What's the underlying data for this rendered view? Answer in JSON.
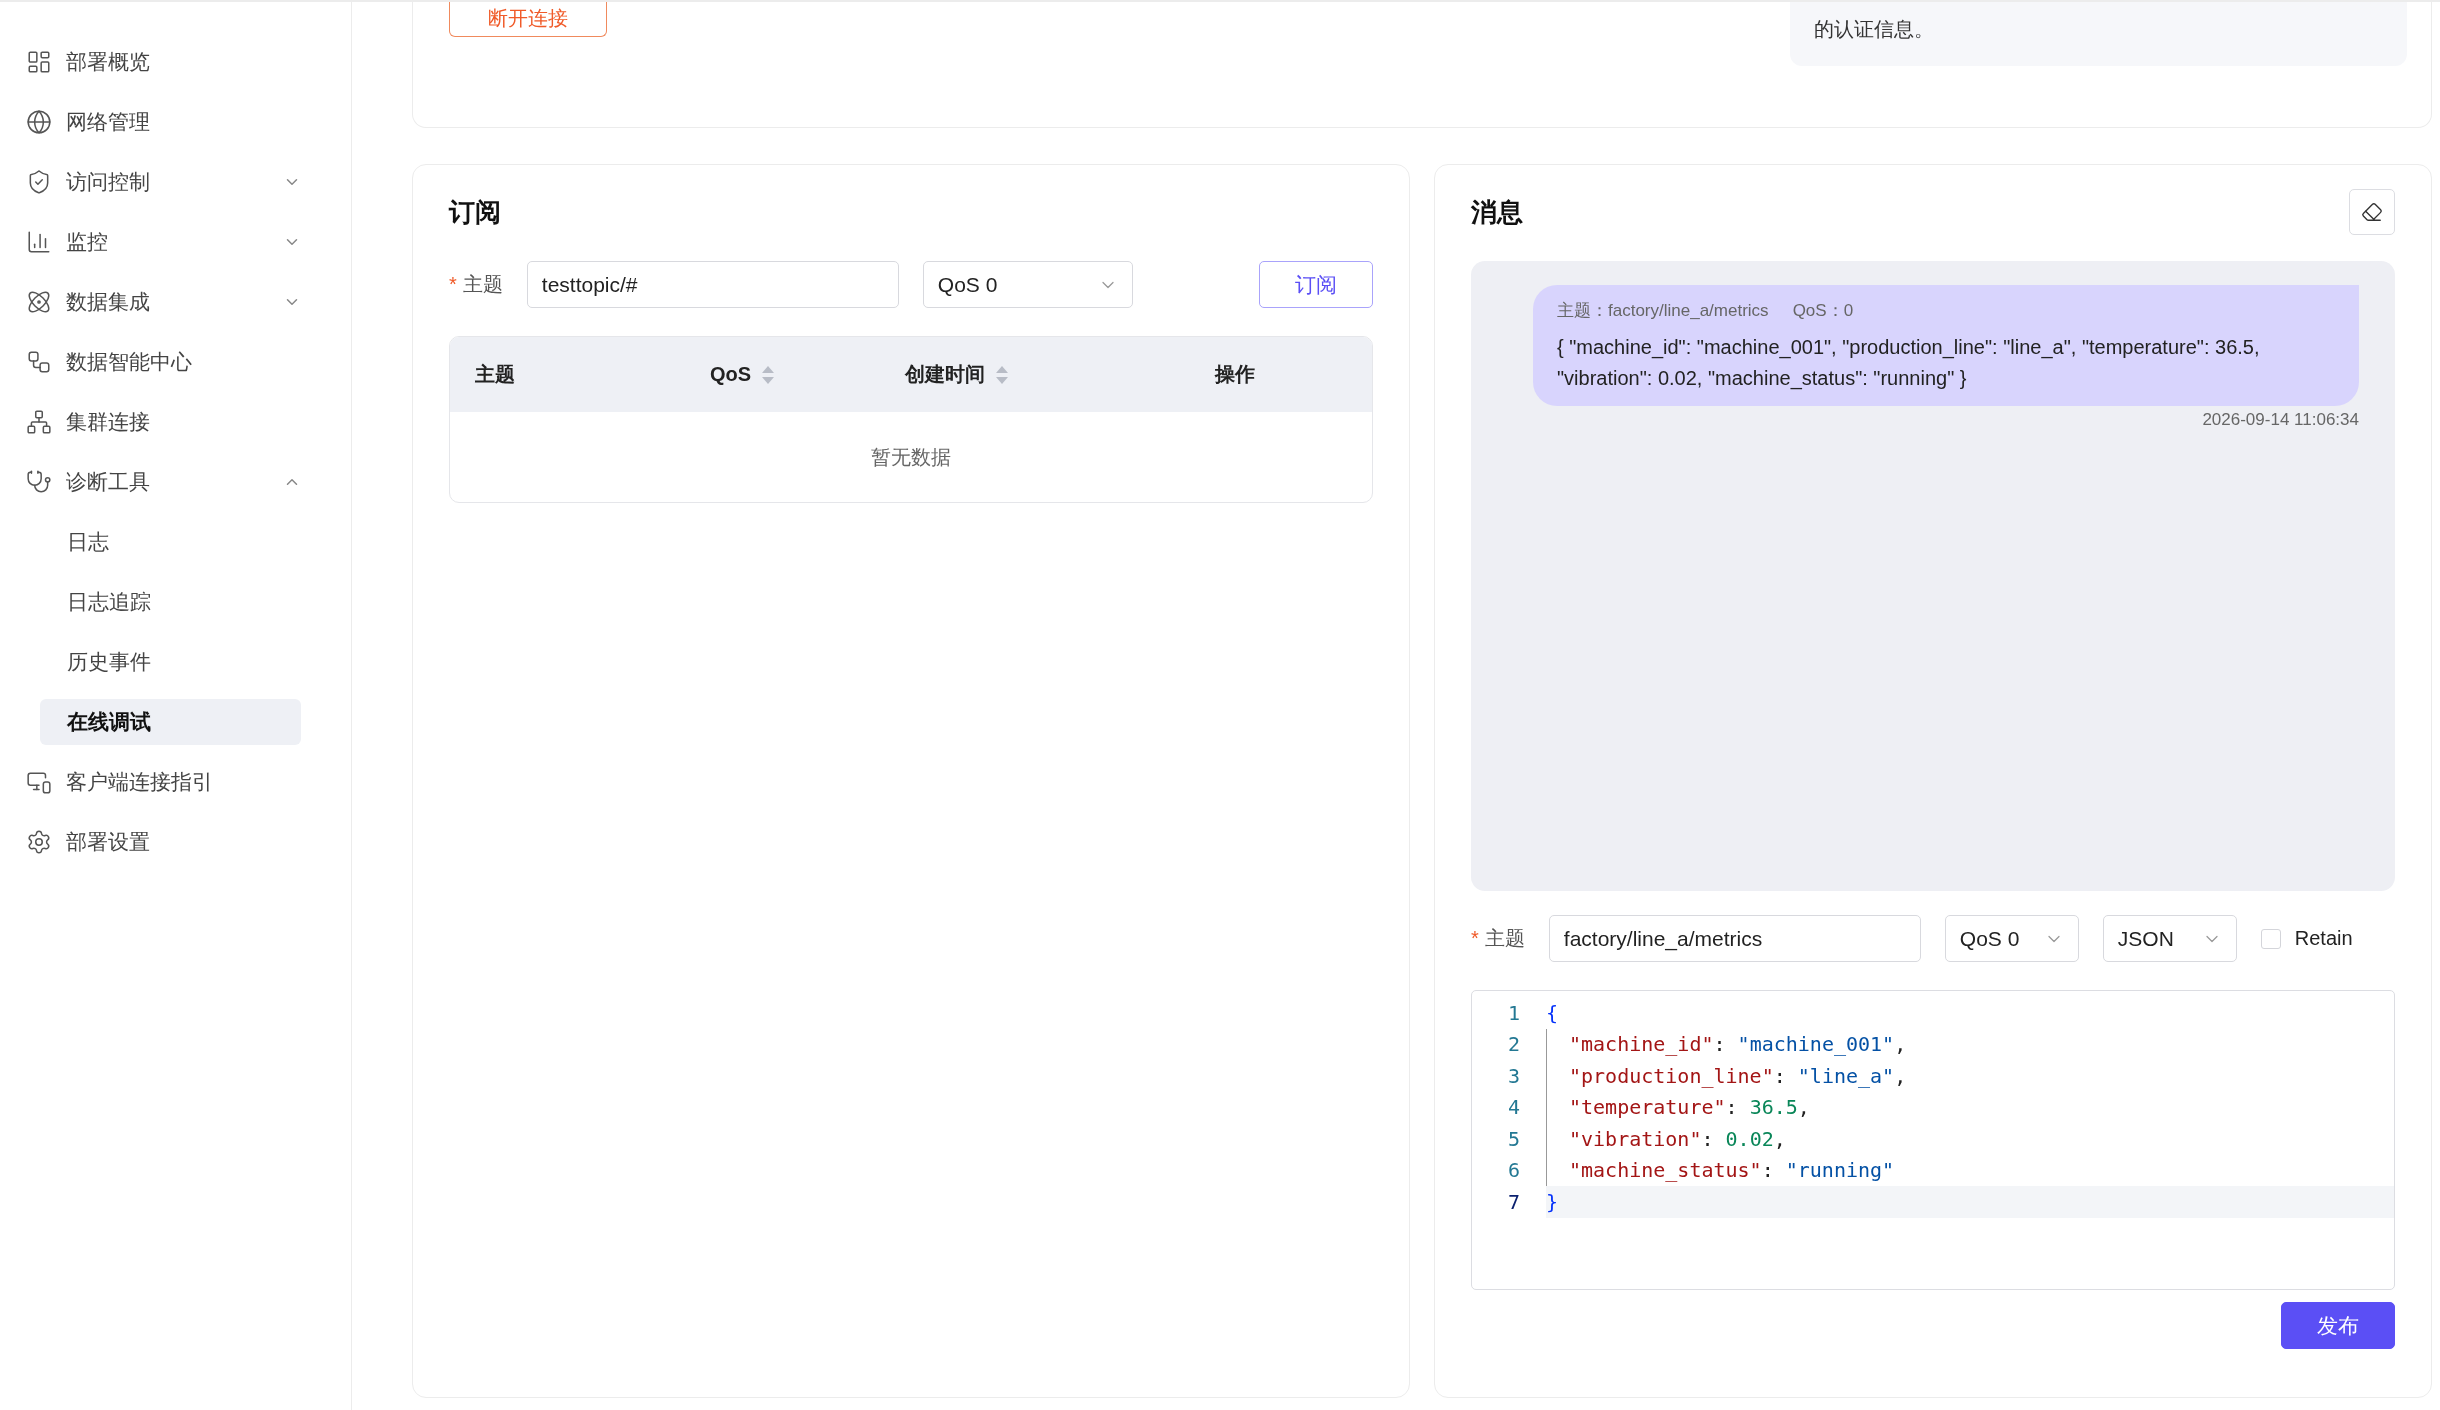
{
  "sidebar": {
    "items": [
      {
        "label": "部署概览",
        "selected": false
      },
      {
        "label": "网络管理",
        "selected": false
      },
      {
        "label": "访问控制",
        "selected": false,
        "expanded": false
      },
      {
        "label": "监控",
        "selected": false,
        "expanded": false
      },
      {
        "label": "数据集成",
        "selected": false,
        "expanded": false
      },
      {
        "label": "数据智能中心",
        "selected": false
      },
      {
        "label": "集群连接",
        "selected": false
      },
      {
        "label": "诊断工具",
        "selected": false,
        "expanded": true,
        "children": [
          {
            "label": "日志",
            "selected": false
          },
          {
            "label": "日志追踪",
            "selected": false
          },
          {
            "label": "历史事件",
            "selected": false
          },
          {
            "label": "在线调试",
            "selected": true
          }
        ]
      },
      {
        "label": "客户端连接指引",
        "selected": false
      },
      {
        "label": "部署设置",
        "selected": false
      }
    ]
  },
  "connection": {
    "disconnect_button": "断开连接",
    "info_text": "的认证信息。"
  },
  "subscribe": {
    "title": "订阅",
    "required_mark": "*",
    "topic_label": "主题",
    "topic_value": "testtopic/#",
    "qos_value": "QoS 0",
    "subscribe_button": "订阅",
    "table": {
      "columns": [
        {
          "label": "主题",
          "sortable": false
        },
        {
          "label": "QoS",
          "sortable": true
        },
        {
          "label": "创建时间",
          "sortable": true
        },
        {
          "label": "操作",
          "sortable": false
        }
      ],
      "empty_text": "暂无数据"
    }
  },
  "messages": {
    "title": "消息",
    "items": [
      {
        "topic": "主题：factory/line_a/metrics",
        "qos": "QoS：0",
        "payload": "{ \"machine_id\": \"machine_001\", \"production_line\": \"line_a\", \"temperature\": 36.5, \"vibration\": 0.02, \"machine_status\": \"running\" }",
        "time": "2026-09-14 11:06:34"
      }
    ],
    "publish": {
      "required_mark": "*",
      "topic_label": "主题",
      "topic_value": "factory/line_a/metrics",
      "qos_value": "QoS 0",
      "format_value": "JSON",
      "retain": false,
      "retain_label": "Retain",
      "publish_button": "发布",
      "code_lines": [
        {
          "number": "1",
          "indent": false,
          "active": false,
          "tokens": [
            {
              "text": "{",
              "kind": "brace"
            }
          ]
        },
        {
          "number": "2",
          "indent": true,
          "active": false,
          "tokens": [
            {
              "text": "\"machine_id\"",
              "kind": "key"
            },
            {
              "text": ": ",
              "kind": "punct"
            },
            {
              "text": "\"machine_001\"",
              "kind": "string"
            },
            {
              "text": ",",
              "kind": "punct"
            }
          ]
        },
        {
          "number": "3",
          "indent": true,
          "active": false,
          "tokens": [
            {
              "text": "\"production_line\"",
              "kind": "key"
            },
            {
              "text": ": ",
              "kind": "punct"
            },
            {
              "text": "\"line_a\"",
              "kind": "string"
            },
            {
              "text": ",",
              "kind": "punct"
            }
          ]
        },
        {
          "number": "4",
          "indent": true,
          "active": false,
          "tokens": [
            {
              "text": "\"temperature\"",
              "kind": "key"
            },
            {
              "text": ": ",
              "kind": "punct"
            },
            {
              "text": "36.5",
              "kind": "number"
            },
            {
              "text": ",",
              "kind": "punct"
            }
          ]
        },
        {
          "number": "5",
          "indent": true,
          "active": false,
          "tokens": [
            {
              "text": "\"vibration\"",
              "kind": "key"
            },
            {
              "text": ": ",
              "kind": "punct"
            },
            {
              "text": "0.02",
              "kind": "number"
            },
            {
              "text": ",",
              "kind": "punct"
            }
          ]
        },
        {
          "number": "6",
          "indent": true,
          "active": false,
          "tokens": [
            {
              "text": "\"machine_status\"",
              "kind": "key"
            },
            {
              "text": ": ",
              "kind": "punct"
            },
            {
              "text": "\"running\"",
              "kind": "string"
            }
          ]
        },
        {
          "number": "7",
          "indent": false,
          "active": true,
          "tokens": [
            {
              "text": "}",
              "kind": "brace"
            }
          ]
        }
      ]
    }
  }
}
